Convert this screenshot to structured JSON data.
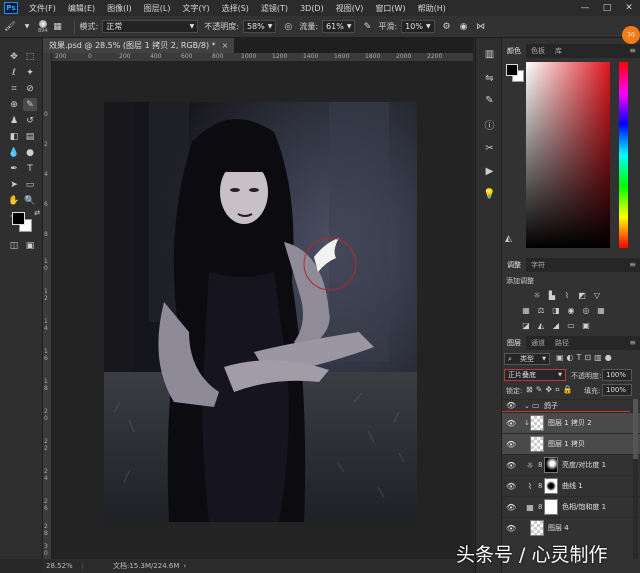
{
  "app": {
    "logo": "Ps"
  },
  "menu": [
    "文件(F)",
    "编辑(E)",
    "图像(I)",
    "图层(L)",
    "文字(Y)",
    "选择(S)",
    "滤镜(T)",
    "3D(D)",
    "视图(V)",
    "窗口(W)",
    "帮助(H)"
  ],
  "window_controls": {
    "minimize": "—",
    "maximize": "□",
    "close": "✕"
  },
  "options": {
    "brush_size": "894",
    "mode_label": "模式:",
    "mode_value": "正常",
    "opacity_label": "不透明度:",
    "opacity_value": "58%",
    "flow_label": "流量:",
    "flow_value": "61%",
    "smooth_label": "平滑:",
    "smooth_value": "10%"
  },
  "document": {
    "tab_title": "效果.psd @ 28.5% (图层 1 拷贝 2, RGB/8) *",
    "close": "×",
    "zoom": "28.52%",
    "info": "文档:15.3M/224.6M"
  },
  "rulers": {
    "top": [
      "200",
      "0",
      "200",
      "400",
      "600",
      "800",
      "1000",
      "1200",
      "1400",
      "1600",
      "1800",
      "2000",
      "2200"
    ],
    "left": [
      "0",
      "2",
      "4",
      "6",
      "8",
      "1 0",
      "1 2",
      "1 4",
      "1 6",
      "1 8",
      "2 0",
      "2 2",
      "2 4",
      "2 6",
      "2 8",
      "3 0"
    ]
  },
  "color_panel": {
    "tabs": [
      "颜色",
      "色板",
      "库"
    ],
    "foreground": "#000000",
    "background": "#ffffff"
  },
  "adjustments_panel": {
    "tabs": [
      "调整",
      "字符"
    ],
    "add_label": "添加调整"
  },
  "layers_panel": {
    "tabs": [
      "图层",
      "通道",
      "路径"
    ],
    "filter_kind": "类型",
    "blend_mode": "正片叠底",
    "opacity_label": "不透明度:",
    "opacity_value": "100%",
    "lock_label": "锁定:",
    "fill_label": "填充:",
    "fill_value": "100%",
    "layers": [
      {
        "name": "鸽子",
        "kind": "group"
      },
      {
        "name": "图层 1 拷贝 2",
        "kind": "pixel",
        "selected": true
      },
      {
        "name": "图层 1 拷贝",
        "kind": "pixel",
        "selected": true
      },
      {
        "name": "亮度/对比度 1",
        "kind": "adjustment"
      },
      {
        "name": "曲线 1",
        "kind": "adjustment"
      },
      {
        "name": "色相/饱和度 1",
        "kind": "adjustment"
      },
      {
        "name": "图层 4",
        "kind": "pixel"
      }
    ]
  },
  "watermark": "头条号 / 心灵制作",
  "badge": "70"
}
